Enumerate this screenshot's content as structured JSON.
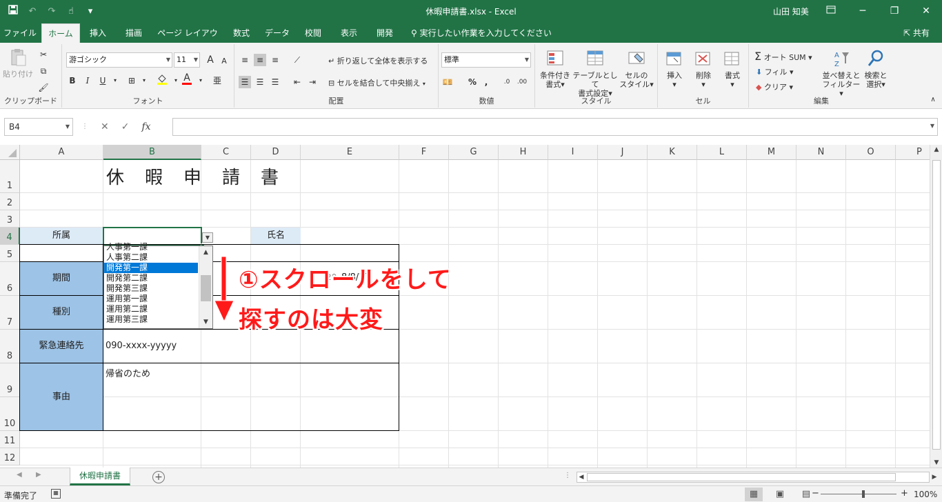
{
  "window": {
    "title": "休暇申請書.xlsx  -  Excel",
    "user": "山田 知美",
    "restore_icon": "ribbon-display-icon",
    "minimize": "─",
    "maximize": "❐",
    "close": "✕"
  },
  "qat": {
    "save": "save-icon",
    "undo": "undo-icon",
    "redo": "redo-icon",
    "touch": "touch-mode-icon",
    "customize": "▾"
  },
  "tabs": [
    "ファイル",
    "ホーム",
    "挿入",
    "描画",
    "ページ レイアウト",
    "数式",
    "データ",
    "校閲",
    "表示",
    "開発"
  ],
  "active_tab": "ホーム",
  "tellme": "実行したい作業を入力してください",
  "share": "共有",
  "ribbon": {
    "clipboard": {
      "paste": "貼り付け",
      "group": "クリップボード"
    },
    "font": {
      "name": "游ゴシック",
      "size": "11",
      "grow": "A",
      "shrink": "A",
      "bold": "B",
      "italic": "I",
      "underline": "U",
      "font_color_letter": "A",
      "group": "フォント"
    },
    "align": {
      "wrap": "折り返して全体を表示する",
      "merge": "セルを結合して中央揃え",
      "group": "配置"
    },
    "number": {
      "format": "標準",
      "percent": "%",
      "comma": ",",
      "group": "数値"
    },
    "styles": {
      "conditional": [
        "条件付き",
        "書式"
      ],
      "table": [
        "テーブルとして",
        "書式設定"
      ],
      "cell": [
        "セルの",
        "スタイル"
      ],
      "group": "スタイル"
    },
    "cells": {
      "insert": "挿入",
      "delete": "削除",
      "format": "書式",
      "group": "セル"
    },
    "editing": {
      "autosum": "オート SUM",
      "fill": "フィル",
      "clear": "クリア",
      "sort": [
        "並べ替えと",
        "フィルター"
      ],
      "find": [
        "検索と",
        "選択"
      ],
      "group": "編集"
    }
  },
  "formula_bar": {
    "name_box": "B4",
    "cancel": "✕",
    "enter": "✓",
    "fx": "fx",
    "value": ""
  },
  "columns": [
    "A",
    "B",
    "C",
    "D",
    "E",
    "F",
    "G",
    "H",
    "I",
    "J",
    "K",
    "L",
    "M",
    "N",
    "O",
    "P"
  ],
  "rows": [
    "1",
    "2",
    "3",
    "4",
    "5",
    "6",
    "7",
    "8",
    "9",
    "10",
    "11",
    "12"
  ],
  "sheet": {
    "title": "休　暇　申　請　書",
    "dept_label": "所属",
    "name_label": "氏名",
    "period_label": "期間",
    "period_value": "8/8/17",
    "period_partial": "20",
    "type_label": "種別",
    "contact_label": "緊急連絡先",
    "contact_value": "090-xxxx-yyyyy",
    "reason_label": "事由",
    "reason_value": "帰省のため"
  },
  "dropdown": {
    "items": [
      "人事第一課",
      "人事第二課",
      "開発第一課",
      "開発第二課",
      "開発第三課",
      "運用第一課",
      "運用第二課",
      "運用第三課"
    ],
    "selected": "開発第一課"
  },
  "annotations": {
    "line1": "①スクロールをして",
    "line2": "探すのは大変"
  },
  "sheet_tabs": [
    "休暇申請書"
  ],
  "add_sheet": "⊕",
  "status": {
    "ready": "準備完了",
    "zoom": "100%",
    "zoom_level": 1.0
  }
}
